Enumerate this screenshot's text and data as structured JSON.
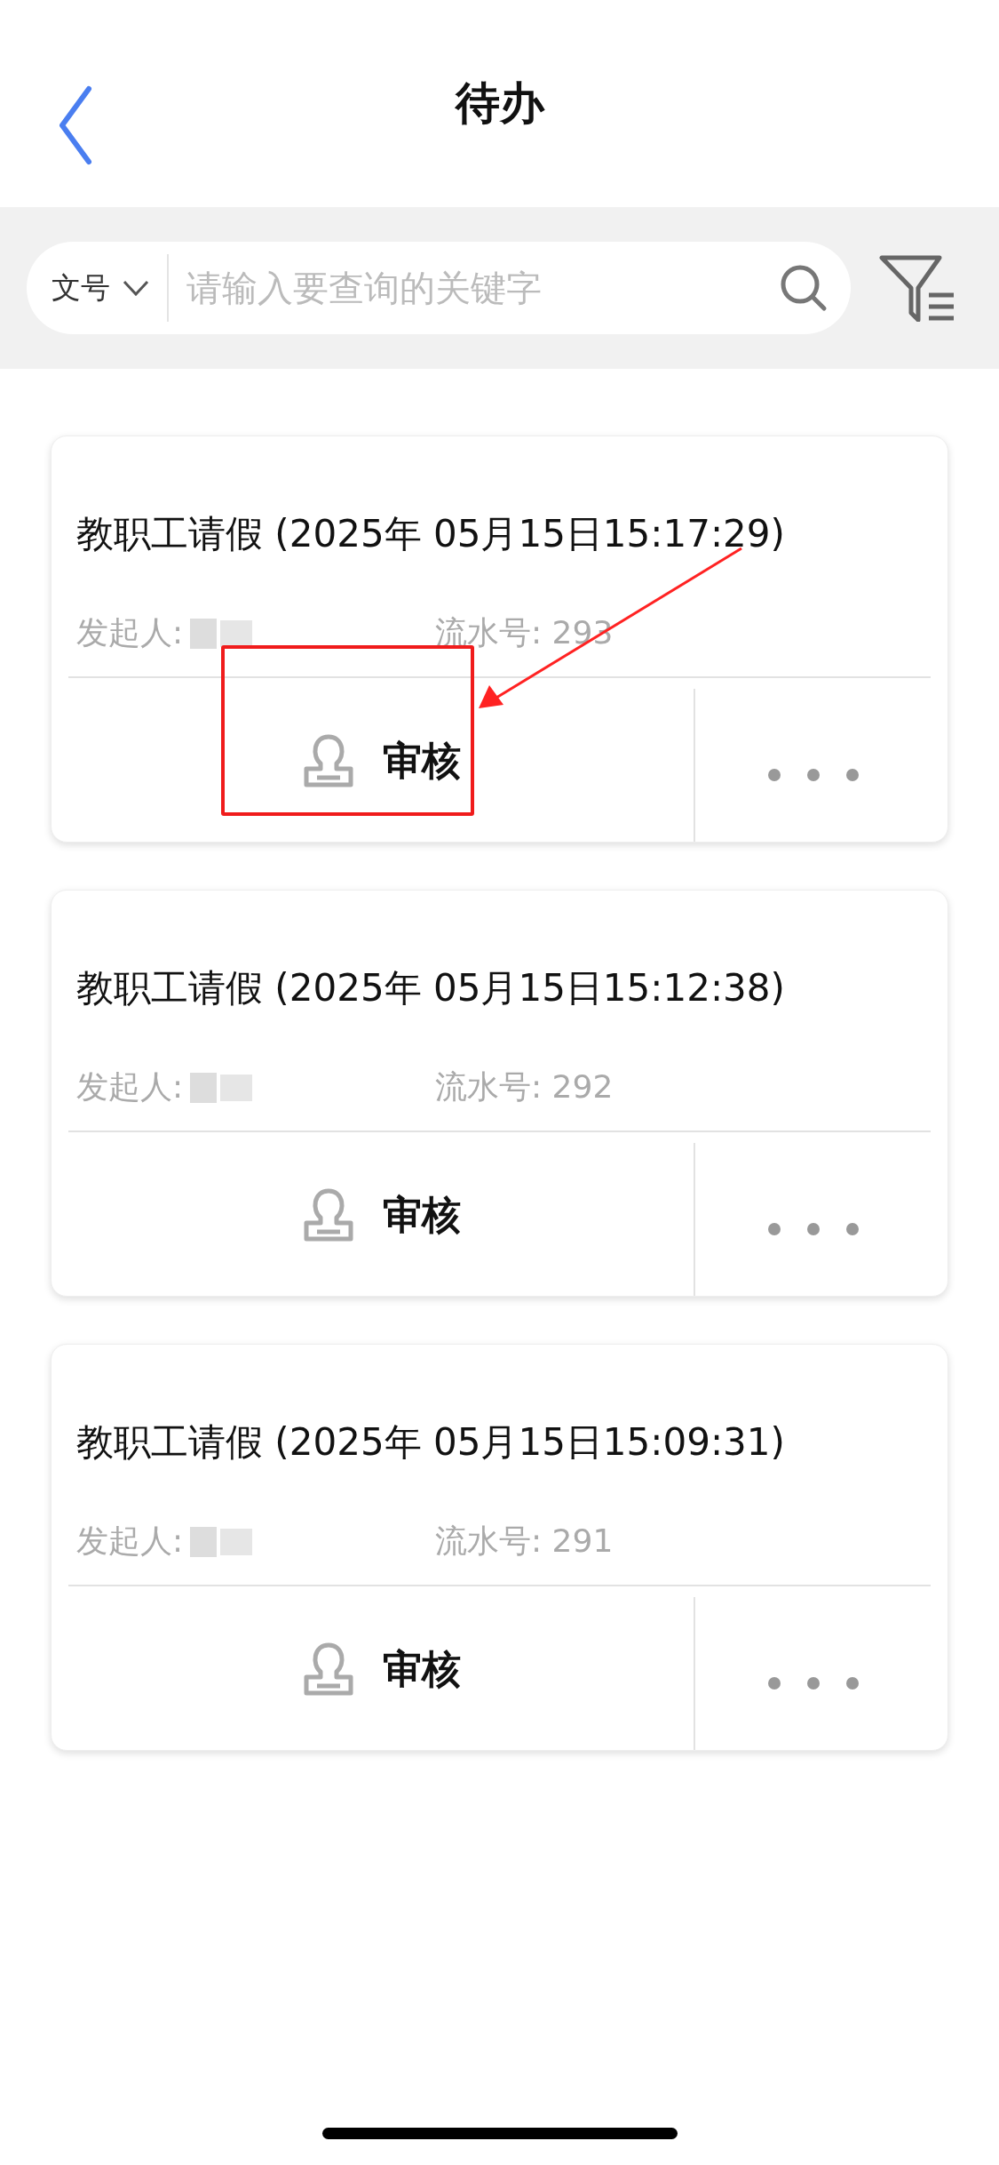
{
  "nav": {
    "title": "待办"
  },
  "search": {
    "scope": "文号",
    "placeholder": "请输入要查询的关键字"
  },
  "cards": [
    {
      "title": "教职工请假 (2025年 05月15日15:17:29)",
      "initiator_label": "发起人:",
      "serial": "流水号: 293",
      "action": "审核",
      "annotated": true
    },
    {
      "title": "教职工请假 (2025年 05月15日15:12:38)",
      "initiator_label": "发起人:",
      "serial": "流水号: 292",
      "action": "审核",
      "annotated": false
    },
    {
      "title": "教职工请假 (2025年 05月15日15:09:31)",
      "initiator_label": "发起人:",
      "serial": "流水号: 291",
      "action": "审核",
      "annotated": false
    }
  ]
}
